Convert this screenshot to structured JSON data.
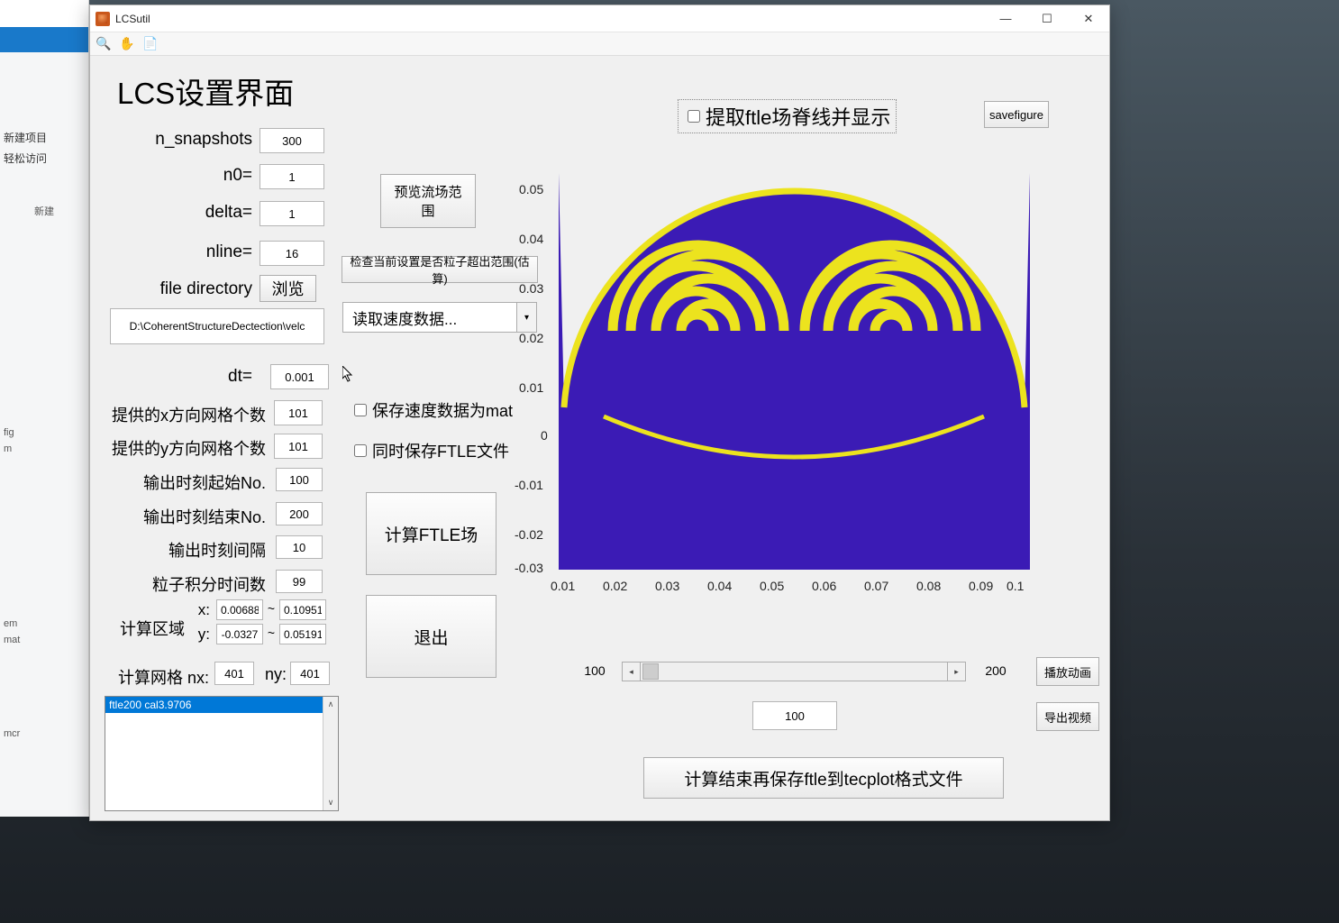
{
  "window": {
    "title": "LCSutil",
    "min": "—",
    "max": "☐",
    "close": "✕"
  },
  "header": {
    "title": "LCS设置界面"
  },
  "leftapp": {
    "item_newproj": "新建项目",
    "item_easyaccess": "轻松访问",
    "label_new": "新建",
    "frag_fig": "fig",
    "frag_m": "m",
    "frag_em": "em",
    "frag_mat": "mat",
    "frag_mcr": "mcr"
  },
  "params": {
    "n_snapshots_label": "n_snapshots",
    "n_snapshots": "300",
    "n0_label": "n0=",
    "n0": "1",
    "delta_label": "delta=",
    "delta": "1",
    "nline_label": "nline=",
    "nline": "16",
    "filedir_label": "file directory",
    "browse": "浏览",
    "path": "D:\\CoherentStructureDectection\\velc",
    "dt_label": "dt=",
    "dt": "0.001",
    "gridx_label": "提供的x方向网格个数",
    "gridx": "101",
    "gridy_label": "提供的y方向网格个数",
    "gridy": "101",
    "out_start_label": "输出时刻起始No.",
    "out_start": "100",
    "out_end_label": "输出时刻结束No.",
    "out_end": "200",
    "out_step_label": "输出时刻间隔",
    "out_step": "10",
    "int_time_label": "粒子积分时间数",
    "int_time": "99",
    "region_label": "计算区域",
    "x_lab": "x:",
    "y_lab": "y:",
    "tilde1": "~",
    "tilde2": "~",
    "x_min": "0.00688",
    "x_max": "0.10951",
    "y_min": "-0.0327",
    "y_max": "0.05191",
    "grid_nx_label": "计算网格 nx:",
    "grid_nx": "401",
    "ny_label": "ny:",
    "grid_ny": "401"
  },
  "buttons": {
    "preview": "预览流场范围",
    "check_range": "检查当前设置是否粒子超出范围(估算)",
    "read_speed": "读取速度数据...",
    "calc_ftle": "计算FTLE场",
    "exit": "退出",
    "savefigure": "savefigure",
    "play_anim": "播放动画",
    "export_video": "导出视频",
    "save_tecplot": "计算结束再保存ftle到tecplot格式文件"
  },
  "checkboxes": {
    "ridge": "提取ftle场脊线并显示",
    "save_mat": "保存速度数据为mat",
    "save_ftle": "同时保存FTLE文件"
  },
  "listbox": {
    "item0": "ftle200 cal3.9706"
  },
  "slider": {
    "min_label": "100",
    "max_label": "200",
    "current": "100"
  },
  "chart_data": {
    "type": "heatmap",
    "title": "",
    "xlabel": "",
    "ylabel": "",
    "xlim": [
      0.01,
      0.1
    ],
    "ylim": [
      -0.03,
      0.05
    ],
    "x_ticks": [
      0.01,
      0.02,
      0.03,
      0.04,
      0.05,
      0.06,
      0.07,
      0.08,
      0.09,
      0.1
    ],
    "y_ticks": [
      -0.03,
      -0.02,
      -0.01,
      0,
      0.01,
      0.02,
      0.03,
      0.04,
      0.05
    ],
    "colormap_levels": [
      "#3b1bb5",
      "#ece31e"
    ],
    "description": "Binary FTLE field showing two counter-rotating spiral vortex ridge structures (yellow) on a dark blue background, bounded above by a near-circular dome and connected below by a thin arc."
  },
  "axis_ticks": {
    "y": [
      "0.05",
      "0.04",
      "0.03",
      "0.02",
      "0.01",
      "0",
      "-0.01",
      "-0.02",
      "-0.03"
    ],
    "x": [
      "0.01",
      "0.02",
      "0.03",
      "0.04",
      "0.05",
      "0.06",
      "0.07",
      "0.08",
      "0.09",
      "0.1"
    ]
  }
}
